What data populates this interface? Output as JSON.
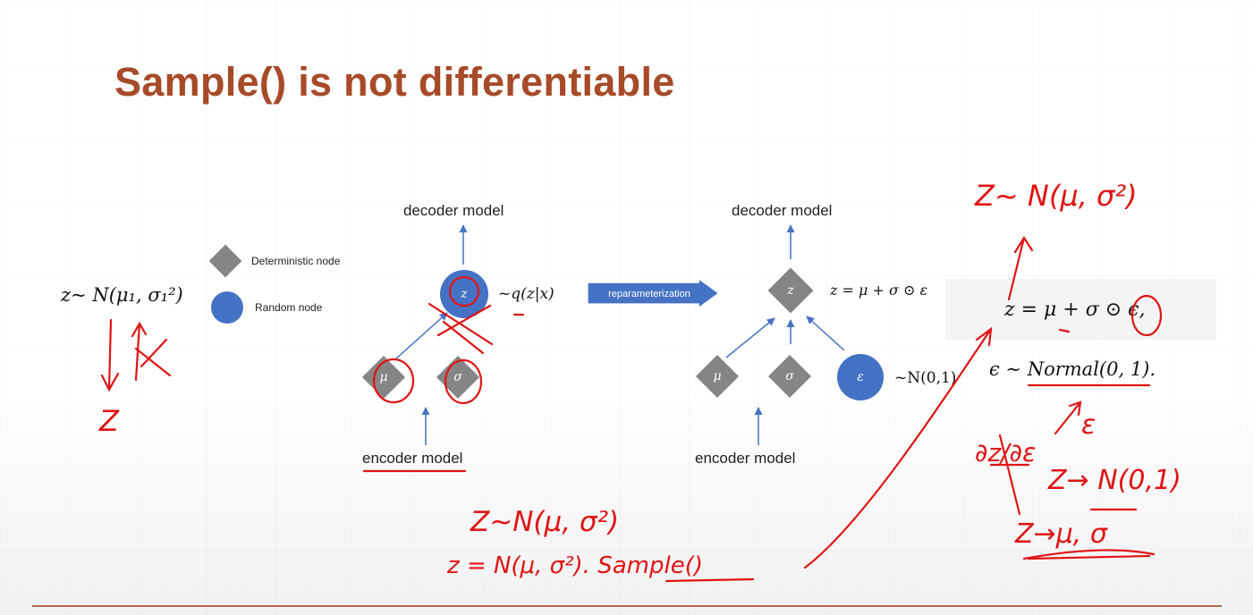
{
  "slide": {
    "title": "Sample() is not differentiable"
  },
  "left_eq": "z~ N(μ₁, σ₁²)",
  "legend": {
    "deterministic": "Deterministic node",
    "random": "Random node"
  },
  "left_diagram": {
    "top_label": "decoder model",
    "bottom_label": "encoder model",
    "z_symbol": "z",
    "mu_symbol": "μ",
    "sigma_symbol": "σ",
    "q_label": "~q(z|x)"
  },
  "reparam_label": "reparameterization",
  "right_diagram": {
    "top_label": "decoder model",
    "bottom_label": "encoder model",
    "z_symbol": "z",
    "mu_symbol": "μ",
    "sigma_symbol": "σ",
    "eps_symbol": "ε",
    "z_eq": "z = μ + σ ⊙ ε",
    "eps_dist": "~N(0,1)"
  },
  "formula": {
    "line1": "z = μ + σ ⊙ ϵ,",
    "line2": "ϵ ∼ Normal(0, 1)."
  },
  "handwriting": {
    "left_z": "Z",
    "top_right": "Z~ N(μ, σ²)",
    "bottom1": "Z~N(μ, σ²)",
    "bottom2": "z = N(μ, σ²). Sample()",
    "eps_note": "ε",
    "deriv": "∂z/∂ε",
    "z_to_n": "Z→ N(0,1)",
    "z_to_mu": "Z→μ, σ"
  }
}
